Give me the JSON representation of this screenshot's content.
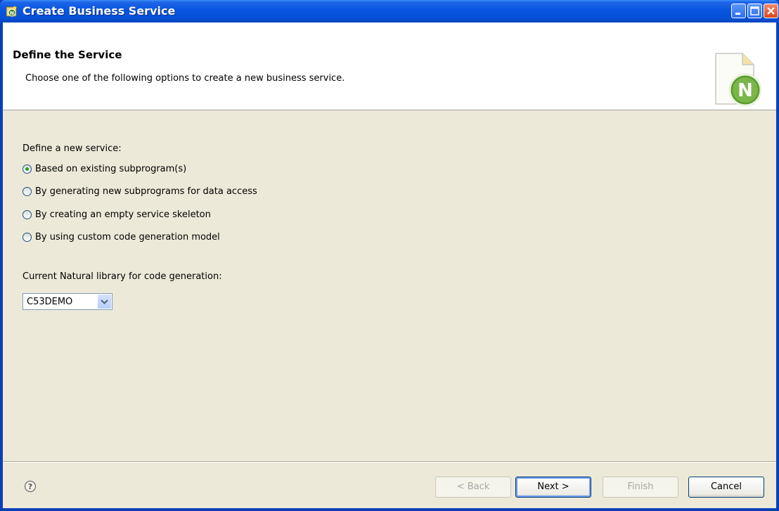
{
  "window": {
    "title": "Create Business Service"
  },
  "header": {
    "title": "Define the Service",
    "description": "Choose one of the following options to create a new business service."
  },
  "define": {
    "label": "Define a new service:",
    "options": [
      {
        "label": "Based on existing subprogram(s)",
        "selected": true
      },
      {
        "label": "By generating new subprograms for data access",
        "selected": false
      },
      {
        "label": "By creating an empty service skeleton",
        "selected": false
      },
      {
        "label": "By using custom code generation model",
        "selected": false
      }
    ]
  },
  "library": {
    "label": "Current Natural library for code generation:",
    "selected": "C53DEMO"
  },
  "buttons": {
    "back": "< Back",
    "next": "Next >",
    "finish": "Finish",
    "cancel": "Cancel"
  },
  "icons": {
    "app": "natural-wizard-icon",
    "help": "help-icon",
    "wizard_banner": "natural-document-icon"
  },
  "colors": {
    "titlebar": "#0656e2",
    "dialog_bg": "#ece9d8",
    "radio_dot": "#21a121",
    "natural_green": "#5a9b2c"
  }
}
